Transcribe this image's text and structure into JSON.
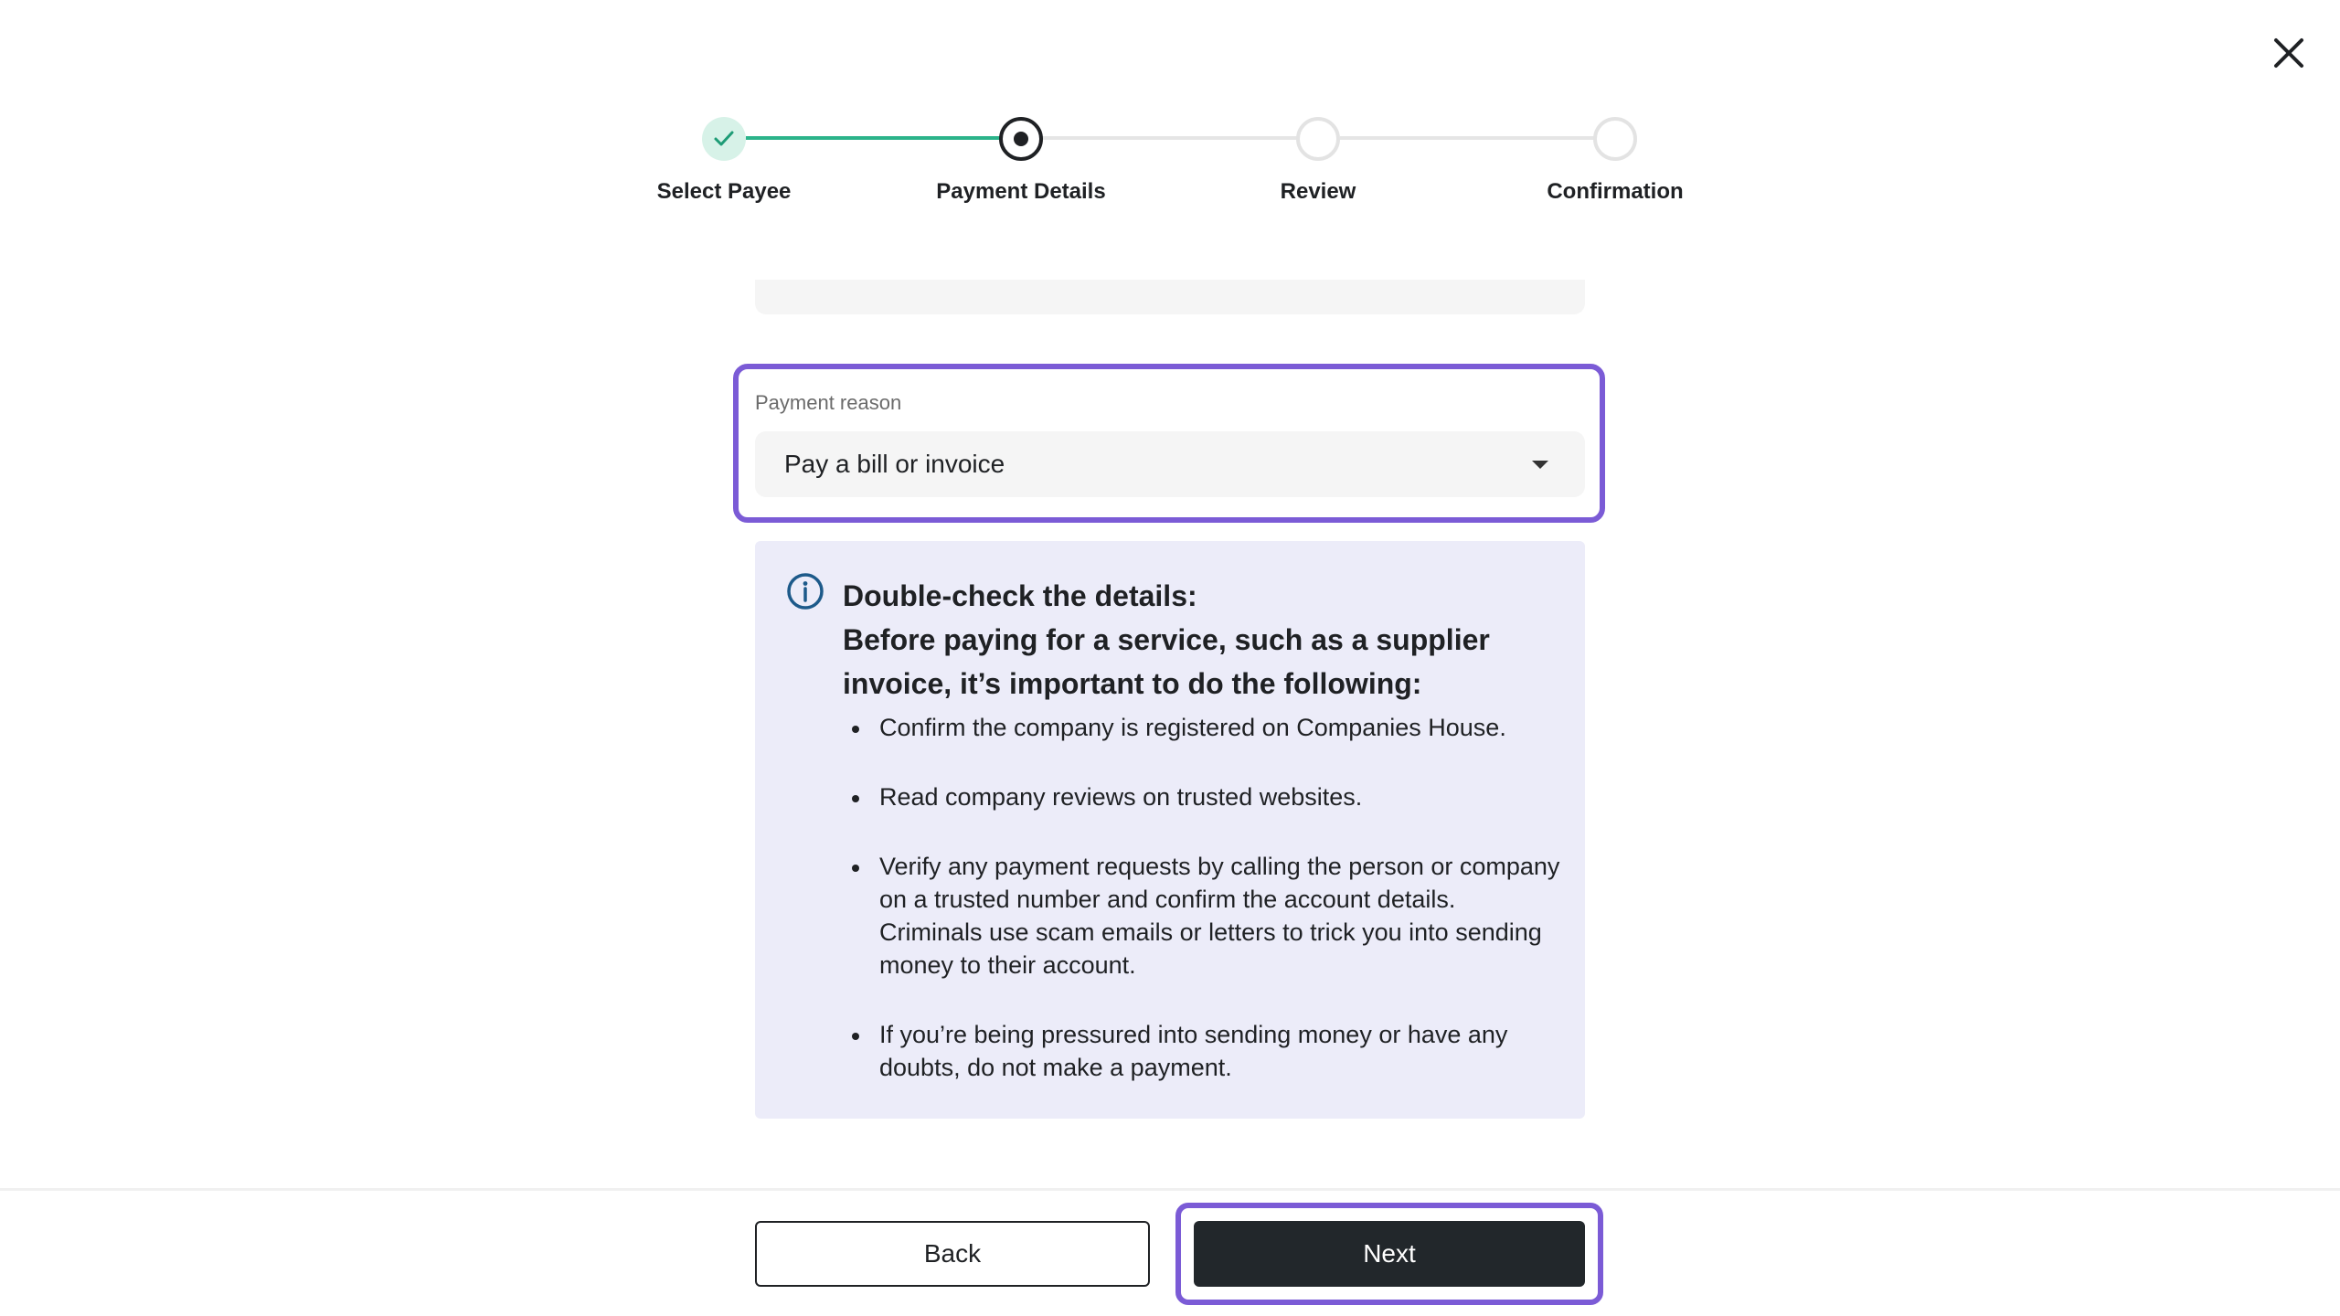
{
  "stepper": {
    "steps": [
      {
        "label": "Select Payee",
        "state": "done"
      },
      {
        "label": "Payment Details",
        "state": "current"
      },
      {
        "label": "Review",
        "state": "todo"
      },
      {
        "label": "Confirmation",
        "state": "todo"
      }
    ]
  },
  "payment_reason": {
    "label": "Payment reason",
    "selected": "Pay a bill or invoice"
  },
  "info": {
    "title_line1": "Double-check the details:",
    "title_line2": "Before paying for a service, such as a supplier invoice, it’s important to do the following:",
    "items": [
      "Confirm the company is registered on Companies House.",
      "Read company reviews on trusted websites.",
      "Verify any payment requests by calling the person or company on a trusted number and confirm the account details. Criminals use scam emails or letters to trick you into sending money to their account.",
      "If you’re being pressured into sending money or have any doubts, do not make a payment."
    ]
  },
  "footer": {
    "back_label": "Back",
    "next_label": "Next"
  },
  "colors": {
    "accent_focus": "#7b5bd6",
    "success": "#2bb38a",
    "info_bg": "#ececf9",
    "primary_button": "#22272b"
  },
  "icons": {
    "close": "close-icon",
    "check": "check-icon",
    "info": "info-icon",
    "dropdown": "chevron-down-icon"
  }
}
